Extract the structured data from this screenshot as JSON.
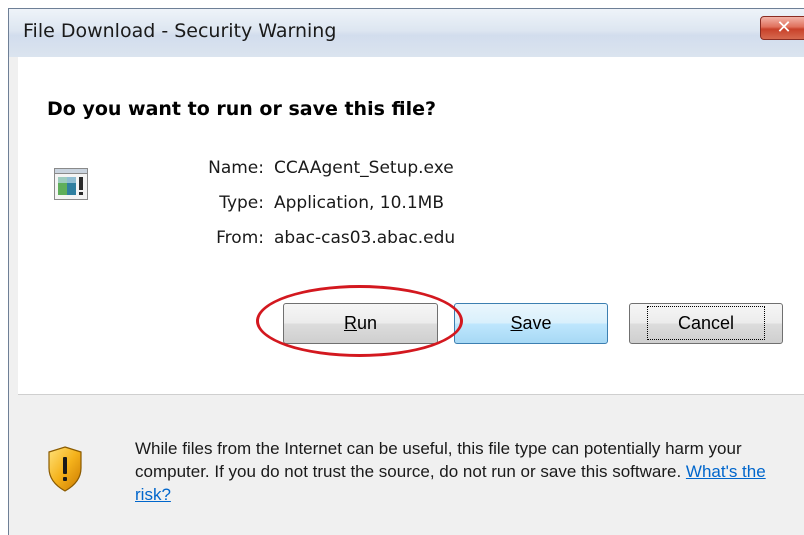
{
  "window": {
    "title": "File Download - Security Warning",
    "close_glyph": "✕"
  },
  "dialog": {
    "question": "Do you want to run or save this file?",
    "file": {
      "name_label": "Name:",
      "name_value": "CCAAgent_Setup.exe",
      "type_label": "Type:",
      "type_value": "Application, 10.1MB",
      "from_label": "From:",
      "from_value": "abac-cas03.abac.edu"
    },
    "buttons": {
      "run_mnemonic": "R",
      "run_rest": "un",
      "save_mnemonic": "S",
      "save_rest": "ave",
      "cancel": "Cancel"
    },
    "warning": {
      "text": "While files from the Internet can be useful, this file type can potentially harm your computer. If you do not trust the source, do not run or save this software. ",
      "risk_link": "What's the risk?"
    }
  },
  "icons": {
    "file_icon": "application-file-icon",
    "warning_icon": "security-shield-icon",
    "close_icon": "close-icon"
  },
  "colors": {
    "highlight": "#d3181f",
    "close_button": "#c8412a",
    "link": "#0066cc",
    "save_button_border": "#3c7fb1"
  }
}
